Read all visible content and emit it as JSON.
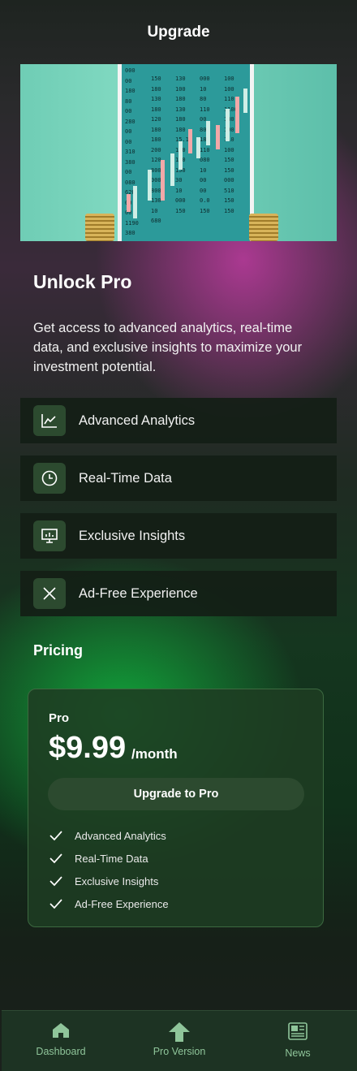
{
  "header": {
    "title": "Upgrade"
  },
  "intro": {
    "title": "Unlock Pro",
    "description": "Get access to advanced analytics, real-time data, and exclusive insights to maximize your investment potential."
  },
  "features": [
    {
      "label": "Advanced Analytics",
      "icon": "chart-line-icon"
    },
    {
      "label": "Real-Time Data",
      "icon": "clock-icon"
    },
    {
      "label": "Exclusive Insights",
      "icon": "presentation-icon"
    },
    {
      "label": "Ad-Free Experience",
      "icon": "close-icon"
    }
  ],
  "pricing": {
    "title": "Pricing",
    "plan": {
      "name": "Pro",
      "price": "$9.99",
      "period": "/month",
      "button_label": "Upgrade to Pro",
      "benefits": [
        "Advanced Analytics",
        "Real-Time Data",
        "Exclusive Insights",
        "Ad-Free Experience"
      ]
    }
  },
  "nav": {
    "items": [
      {
        "label": "Dashboard",
        "icon": "home-icon"
      },
      {
        "label": "Pro Version",
        "icon": "arrow-up-icon"
      },
      {
        "label": "News",
        "icon": "newspaper-icon"
      }
    ]
  },
  "colors": {
    "accent_green": "#2c4a2f",
    "nav_label": "#8fc59a",
    "card_border": "#3c6a40"
  }
}
